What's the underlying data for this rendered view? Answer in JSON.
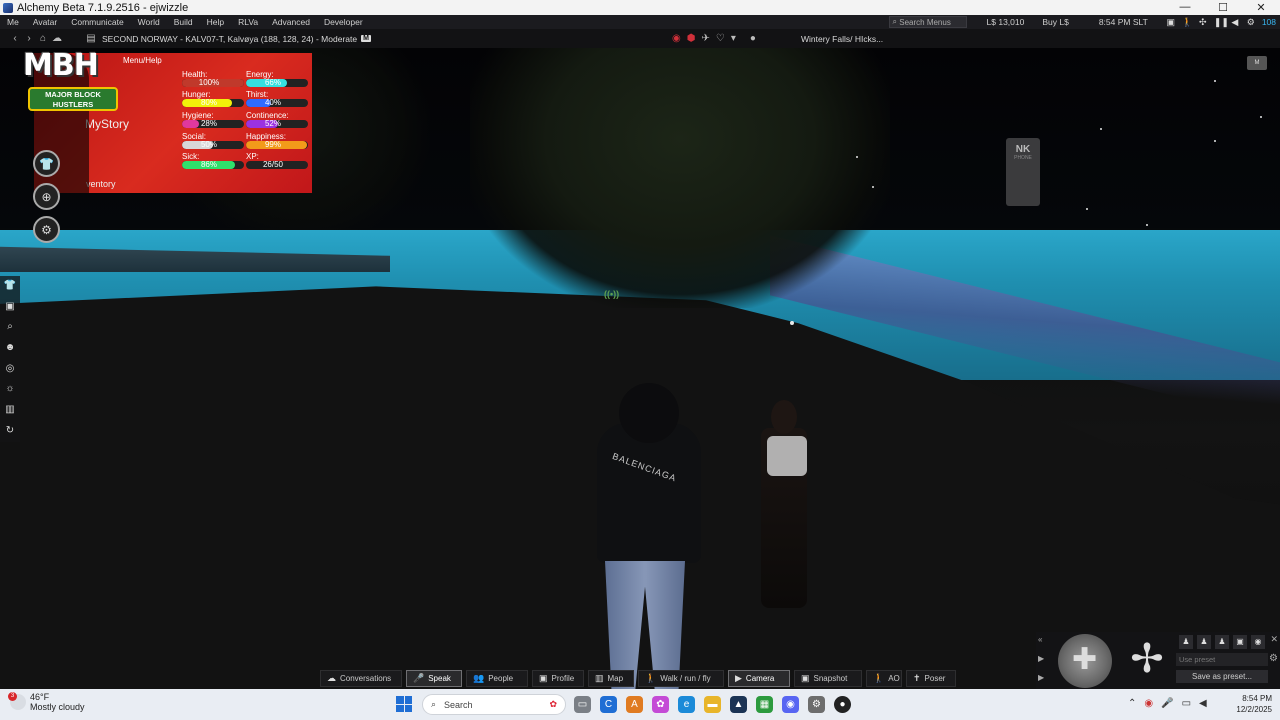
{
  "window": {
    "title": "Alchemy Beta 7.1.9.2516 - ejwizzle",
    "controls": [
      "—",
      "☐",
      "✕"
    ]
  },
  "menubar": {
    "items": [
      "Me",
      "Avatar",
      "Communicate",
      "World",
      "Build",
      "Help",
      "RLVa",
      "Advanced",
      "Developer"
    ],
    "search_placeholder": "Search Menus",
    "balance": "L$ 13,010",
    "buy": "Buy L$",
    "time": "8:54 PM SLT",
    "fps": "108"
  },
  "navbar": {
    "location": "SECOND NORWAY - KALV07-T, Kalvøya (188, 128, 24) - Moderate",
    "maturity_badge": "M",
    "region_info": "Wintery Falls/ HIcks..."
  },
  "hud": {
    "logo_title": "MBH",
    "logo_sub1": "MAJOR BLOCK",
    "logo_sub2": "HUSTLERS",
    "menu_help": "Menu/Help",
    "mystory": "MyStory",
    "inventory": "ventory",
    "stats": [
      {
        "label": "Health:",
        "value": "100%",
        "level": 1.0,
        "color": "#c0392b"
      },
      {
        "label": "Energy:",
        "value": "66%",
        "level": 0.66,
        "color": "#35e0e0"
      },
      {
        "label": "Hunger:",
        "value": "80%",
        "level": 0.8,
        "color": "#f2f20a"
      },
      {
        "label": "Thirst:",
        "value": "40%",
        "level": 0.4,
        "color": "#2f6bff"
      },
      {
        "label": "Hygiene:",
        "value": "28%",
        "level": 0.28,
        "color": "#e0389e"
      },
      {
        "label": "Continence:",
        "value": "52%",
        "level": 0.52,
        "color": "#9b32e0"
      },
      {
        "label": "Social:",
        "value": "50%",
        "level": 0.5,
        "color": "#d8d8d8"
      },
      {
        "label": "Happiness:",
        "value": "99%",
        "level": 0.99,
        "color": "#f29a1a"
      },
      {
        "label": "Sick:",
        "value": "86%",
        "level": 0.86,
        "color": "#2fe06b"
      },
      {
        "label": "XP:",
        "value": "26/50",
        "level": 0.0,
        "color": "#1a1a1a"
      }
    ]
  },
  "scene": {
    "voice_indicator": "((•))",
    "nk_label": "NK",
    "nk_sub": "PHONE",
    "shirt_text": "BALENCIAGA",
    "mini_label": "M"
  },
  "camera_controls": {
    "preset_placeholder": "Use preset",
    "save_preset": "Save as preset..."
  },
  "bottom_toolbar": [
    {
      "label": "Conversations",
      "icon": "chat-icon",
      "glyph": "☁",
      "active": false
    },
    {
      "label": "Speak",
      "icon": "microphone-icon",
      "glyph": "🎤",
      "active": true
    },
    {
      "label": "People",
      "icon": "people-icon",
      "glyph": "👥",
      "active": false
    },
    {
      "label": "Profile",
      "icon": "profile-icon",
      "glyph": "▣",
      "active": false
    },
    {
      "label": "Map",
      "icon": "map-icon",
      "glyph": "▥",
      "active": false
    },
    {
      "label": "Walk / run / fly",
      "icon": "walk-icon",
      "glyph": "🚶",
      "active": false
    },
    {
      "label": "Camera",
      "icon": "camera-icon",
      "glyph": "▶",
      "active": true
    },
    {
      "label": "Snapshot",
      "icon": "snapshot-icon",
      "glyph": "▣",
      "active": false
    },
    {
      "label": "AO",
      "icon": "ao-icon",
      "glyph": "🚶",
      "active": false
    },
    {
      "label": "Poser",
      "icon": "poser-icon",
      "glyph": "✝",
      "active": false
    }
  ],
  "taskbar": {
    "temperature": "46°F",
    "weather": "Mostly cloudy",
    "weather_badge": "3",
    "search": "Search",
    "time": "8:54 PM",
    "date": "12/2/2025"
  }
}
